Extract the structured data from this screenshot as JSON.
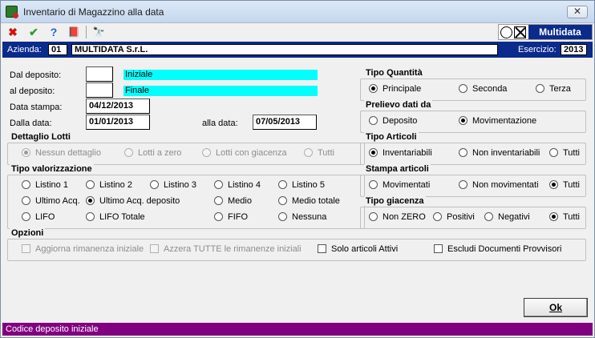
{
  "window": {
    "title": "Inventario di Magazzino alla data",
    "close_label": "✕"
  },
  "toolbar": {
    "cancel_icon": "✖",
    "confirm_icon": "✔",
    "help_icon": "?",
    "book_icon": "📕",
    "search_icon": "🔭",
    "logo_text": "Multidata"
  },
  "header": {
    "azienda_label": "Azienda:",
    "azienda_code": "01",
    "azienda_name": "MULTIDATA S.r.L.",
    "esercizio_label": "Esercizio:",
    "esercizio_value": "2013"
  },
  "form": {
    "dal_deposito_label": "Dal deposito:",
    "dal_deposito_value": "",
    "dal_deposito_desc": "Iniziale",
    "al_deposito_label": "al deposito:",
    "al_deposito_value": "",
    "al_deposito_desc": "Finale",
    "data_stampa_label": "Data stampa:",
    "data_stampa_value": "04/12/2013",
    "dalla_data_label": "Dalla data:",
    "dalla_data_value": "01/01/2013",
    "alla_data_label": "alla data:",
    "alla_data_value": "07/05/2013"
  },
  "dettaglio_lotti": {
    "title": "Dettaglio Lotti",
    "options": [
      "Nessun dettaglio",
      "Lotti a zero",
      "Lotti con giacenza",
      "Tutti"
    ]
  },
  "tipo_valorizzazione": {
    "title": "Tipo valorizzazione",
    "options": [
      "Listino 1",
      "Listino 2",
      "Listino 3",
      "Listino 4",
      "Listino 5",
      "Ultimo Acq.",
      "Ultimo Acq. deposito",
      "Medio",
      "Medio totale",
      "LIFO",
      "LIFO Totale",
      "FIFO",
      "Nessuna"
    ]
  },
  "opzioni": {
    "title": "Opzioni",
    "options": [
      "Aggiorna rimanenza iniziale",
      "Azzera TUTTE le rimanenze iniziali",
      "Solo articoli Attivi",
      "Escludi Documenti Provvisori"
    ]
  },
  "tipo_quantita": {
    "title": "Tipo Quantità",
    "options": [
      "Principale",
      "Seconda",
      "Terza"
    ]
  },
  "prelievo": {
    "title": "Prelievo dati da",
    "options": [
      "Deposito",
      "Movimentazione"
    ]
  },
  "tipo_articoli": {
    "title": "Tipo Articoli",
    "options": [
      "Inventariabili",
      "Non inventariabili",
      "Tutti"
    ]
  },
  "stampa_articoli": {
    "title": "Stampa articoli",
    "options": [
      "Movimentati",
      "Non movimentati",
      "Tutti"
    ]
  },
  "tipo_giacenza": {
    "title": "Tipo giacenza",
    "options": [
      "Non ZERO",
      "Positivi",
      "Negativi",
      "Tutti"
    ]
  },
  "buttons": {
    "ok_label": "Ok"
  },
  "status": {
    "text": "Codice deposito iniziale"
  }
}
